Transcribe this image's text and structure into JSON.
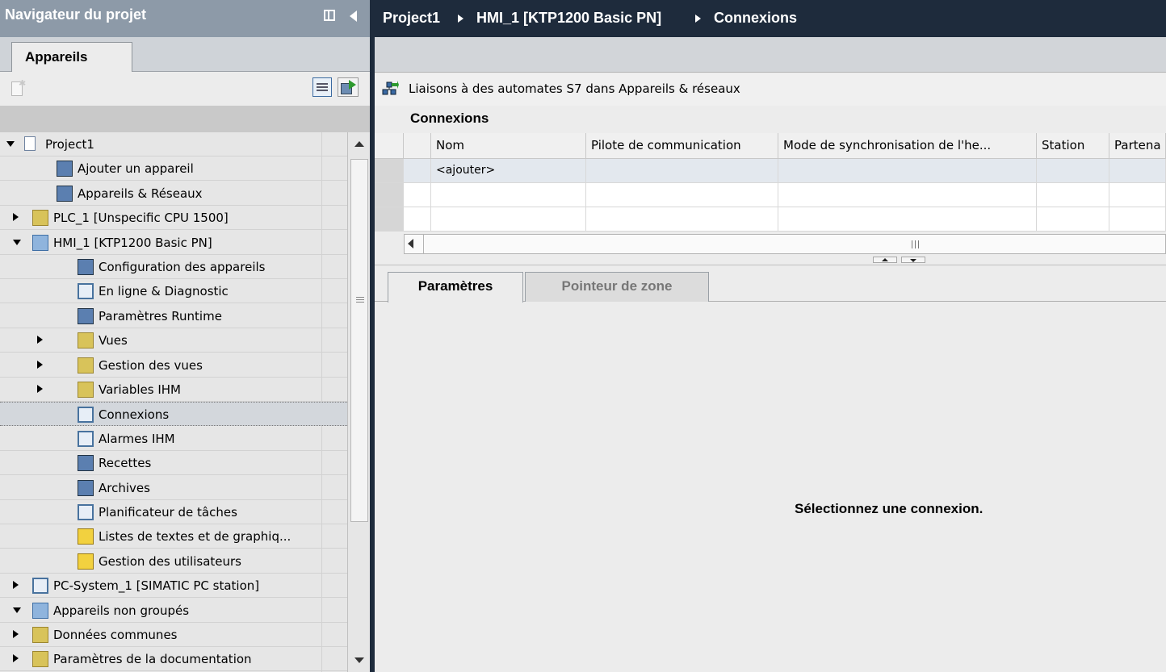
{
  "navigator": {
    "title": "Navigateur du projet",
    "tab_label": "Appareils",
    "tree": [
      {
        "label": "Project1",
        "icon": "project-page-icon",
        "level": 0,
        "expander": "open"
      },
      {
        "label": "Ajouter un appareil",
        "icon": "add-device-icon",
        "level": 1,
        "expander": "none"
      },
      {
        "label": "Appareils & Réseaux",
        "icon": "devices-networks-icon",
        "level": 1,
        "expander": "none"
      },
      {
        "label": "PLC_1 [Unspecific CPU 1500]",
        "icon": "plc-folder-icon",
        "level": 1,
        "expander": "closed"
      },
      {
        "label": "HMI_1 [KTP1200 Basic PN]",
        "icon": "hmi-folder-icon",
        "level": 1,
        "expander": "open"
      },
      {
        "label": "Configuration des appareils",
        "icon": "device-config-icon",
        "level": 2,
        "expander": "none"
      },
      {
        "label": "En ligne & Diagnostic",
        "icon": "online-diagnostic-icon",
        "level": 2,
        "expander": "none"
      },
      {
        "label": "Paramètres Runtime",
        "icon": "runtime-settings-icon",
        "level": 2,
        "expander": "none"
      },
      {
        "label": "Vues",
        "icon": "screens-folder-icon",
        "level": 2,
        "expander": "closed"
      },
      {
        "label": "Gestion des vues",
        "icon": "screen-management-icon",
        "level": 2,
        "expander": "closed"
      },
      {
        "label": "Variables IHM",
        "icon": "hmi-tags-icon",
        "level": 2,
        "expander": "closed"
      },
      {
        "label": "Connexions",
        "icon": "connections-icon",
        "level": 2,
        "expander": "none",
        "selected": true
      },
      {
        "label": "Alarmes IHM",
        "icon": "hmi-alarms-icon",
        "level": 2,
        "expander": "none"
      },
      {
        "label": "Recettes",
        "icon": "recipes-icon",
        "level": 2,
        "expander": "none"
      },
      {
        "label": "Archives",
        "icon": "archives-icon",
        "level": 2,
        "expander": "none"
      },
      {
        "label": "Planificateur de tâches",
        "icon": "scheduler-icon",
        "level": 2,
        "expander": "none"
      },
      {
        "label": "Listes de textes et de graphiq...",
        "icon": "text-graphic-lists-icon",
        "level": 2,
        "expander": "none"
      },
      {
        "label": "Gestion des utilisateurs",
        "icon": "user-admin-icon",
        "level": 2,
        "expander": "none"
      },
      {
        "label": "PC-System_1 [SIMATIC PC station]",
        "icon": "pc-system-icon",
        "level": 1,
        "expander": "closed"
      },
      {
        "label": "Appareils non groupés",
        "icon": "ungrouped-devices-icon",
        "level": 1,
        "expander": "open"
      },
      {
        "label": "Données communes",
        "icon": "common-data-icon",
        "level": 1,
        "expander": "closed"
      },
      {
        "label": "Paramètres de la documentation",
        "icon": "documentation-settings-icon",
        "level": 1,
        "expander": "closed"
      }
    ]
  },
  "breadcrumb": [
    "Project1",
    "HMI_1 [KTP1200 Basic PN]",
    "Connexions"
  ],
  "editor": {
    "link_text": "Liaisons à des automates S7 dans Appareils & réseaux",
    "section_title": "Connexions",
    "columns": [
      "Nom",
      "Pilote de communication",
      "Mode de synchronisation de l'he...",
      "Station",
      "Partena"
    ],
    "add_row_text": "<ajouter>",
    "tabs": [
      "Paramètres",
      "Pointeur de zone"
    ],
    "empty_message": "Sélectionnez une connexion."
  },
  "colors": {
    "title_bar": "#8d9aa8",
    "header_dark": "#1e2b3c",
    "panel_bg": "#ececec"
  }
}
